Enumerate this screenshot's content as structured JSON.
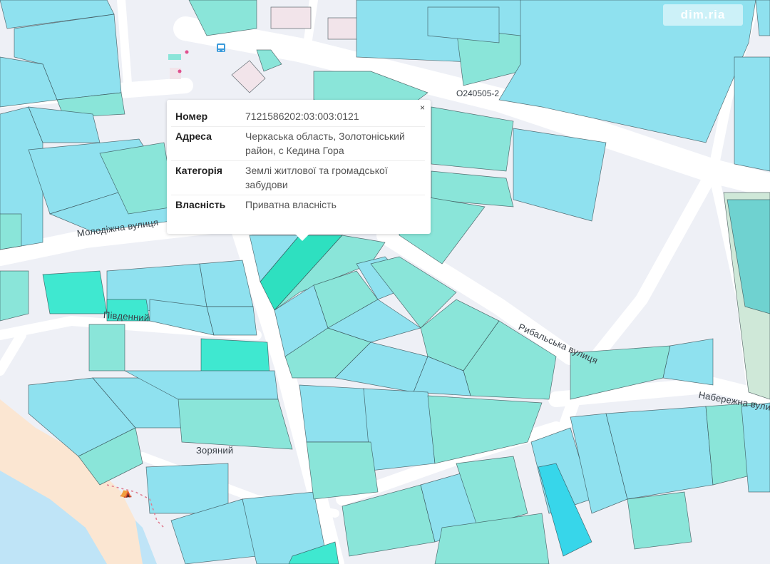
{
  "watermark": "dim.ria",
  "road_code": "O240505-2",
  "streets": {
    "molodizhna": "Молодіжна вулиця",
    "pivdennyi": "Південний",
    "rybalska": "Рибальська вулиця",
    "naberezhna": "Набережна вулиця",
    "zorianyi": "Зоряний"
  },
  "popup": {
    "close": "×",
    "rows": [
      {
        "label": "Номер",
        "value": "7121586202:03:003:0121"
      },
      {
        "label": "Адреса",
        "value": "Черкаська область, Золотоніський район, с Кедина Гора"
      },
      {
        "label": "Категорія",
        "value": "Землі житлової та громадської забудови"
      },
      {
        "label": "Власність",
        "value": "Приватна власність"
      }
    ]
  },
  "colors": {
    "background": "#eef0f6",
    "parcel_blue": "#8fe1ef",
    "parcel_teal": "#8ae5d9",
    "parcel_selected": "#2ee0c0",
    "parcel_highlight": "#3fe8d0",
    "parcel_dark_blue": "#37d6ea",
    "beach": "#fbe6d2",
    "water": "#bfe4f7"
  }
}
